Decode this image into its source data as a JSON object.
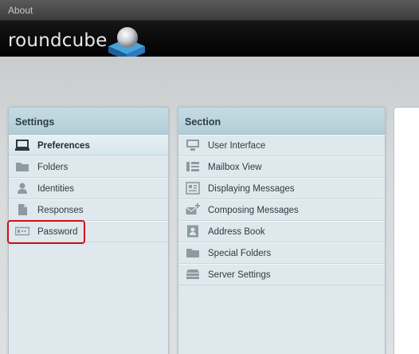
{
  "topbar": {
    "about_label": "About"
  },
  "header": {
    "logo_text": "roundcube"
  },
  "settings": {
    "title": "Settings",
    "items": [
      {
        "label": "Preferences",
        "icon": "monitor-icon",
        "selected": true
      },
      {
        "label": "Folders",
        "icon": "folder-icon",
        "selected": false
      },
      {
        "label": "Identities",
        "icon": "person-icon",
        "selected": false
      },
      {
        "label": "Responses",
        "icon": "document-icon",
        "selected": false
      },
      {
        "label": "Password",
        "icon": "password-icon",
        "selected": false
      }
    ]
  },
  "section": {
    "title": "Section",
    "items": [
      {
        "label": "User Interface",
        "icon": "monitor-icon"
      },
      {
        "label": "Mailbox View",
        "icon": "mailbox-view-icon"
      },
      {
        "label": "Displaying Messages",
        "icon": "message-display-icon"
      },
      {
        "label": "Composing Messages",
        "icon": "compose-icon"
      },
      {
        "label": "Address Book",
        "icon": "address-book-icon"
      },
      {
        "label": "Special Folders",
        "icon": "folder-icon"
      },
      {
        "label": "Server Settings",
        "icon": "server-icon"
      }
    ]
  },
  "colors": {
    "highlight": "#d0101a",
    "panel_header": "#b8d0da",
    "panel_body": "#dfe8ec"
  }
}
